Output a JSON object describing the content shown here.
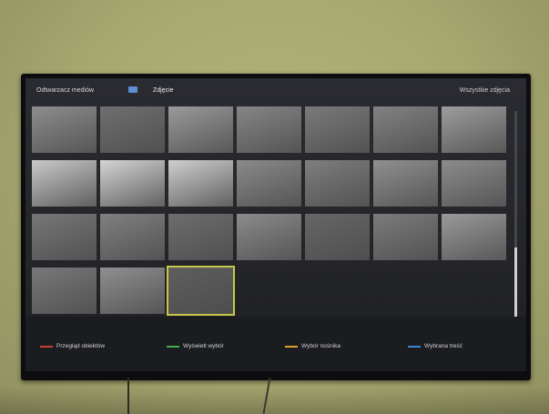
{
  "header": {
    "app_title": "Odtwarzacz mediów",
    "breadcrumb": "Zdjęcie",
    "filter_label": "Wszystkie zdjęcia"
  },
  "photos": [
    {
      "row": 0,
      "col": 0,
      "tone": "#8d8d8d",
      "selected": false
    },
    {
      "row": 0,
      "col": 1,
      "tone": "#6f6f6f",
      "selected": false
    },
    {
      "row": 0,
      "col": 2,
      "tone": "#9a9a9a",
      "selected": false
    },
    {
      "row": 0,
      "col": 3,
      "tone": "#868686",
      "selected": false
    },
    {
      "row": 0,
      "col": 4,
      "tone": "#7a7a7a",
      "selected": false
    },
    {
      "row": 0,
      "col": 5,
      "tone": "#828282",
      "selected": false
    },
    {
      "row": 0,
      "col": 6,
      "tone": "#9d9d9d",
      "selected": false
    },
    {
      "row": 1,
      "col": 0,
      "tone": "#c9c9c9",
      "selected": false
    },
    {
      "row": 1,
      "col": 1,
      "tone": "#d4d4d4",
      "selected": false
    },
    {
      "row": 1,
      "col": 2,
      "tone": "#cfcfcf",
      "selected": false
    },
    {
      "row": 1,
      "col": 3,
      "tone": "#8a8a8a",
      "selected": false
    },
    {
      "row": 1,
      "col": 4,
      "tone": "#7e7e7e",
      "selected": false
    },
    {
      "row": 1,
      "col": 5,
      "tone": "#909090",
      "selected": false
    },
    {
      "row": 1,
      "col": 6,
      "tone": "#8c8c8c",
      "selected": false
    },
    {
      "row": 2,
      "col": 0,
      "tone": "#777777",
      "selected": false
    },
    {
      "row": 2,
      "col": 1,
      "tone": "#808080",
      "selected": false
    },
    {
      "row": 2,
      "col": 2,
      "tone": "#6d6d6d",
      "selected": false
    },
    {
      "row": 2,
      "col": 3,
      "tone": "#8b8b8b",
      "selected": false
    },
    {
      "row": 2,
      "col": 4,
      "tone": "#666666",
      "selected": false
    },
    {
      "row": 2,
      "col": 5,
      "tone": "#7b7b7b",
      "selected": false
    },
    {
      "row": 2,
      "col": 6,
      "tone": "#9a9a9a",
      "selected": false
    },
    {
      "row": 3,
      "col": 0,
      "tone": "#787878",
      "selected": false
    },
    {
      "row": 3,
      "col": 1,
      "tone": "#8f8f8f",
      "selected": false
    },
    {
      "row": 3,
      "col": 2,
      "tone": "#5e5e5e",
      "selected": true
    }
  ],
  "hints": [
    {
      "color": "#d03a3a",
      "label": "Przegląd obiektów"
    },
    {
      "color": "#3fae4a",
      "label": "Wyświetl wybór"
    },
    {
      "color": "#e0a030",
      "label": "Wybór nośnika"
    },
    {
      "color": "#3a86d0",
      "label": "Wybrana treść"
    }
  ]
}
